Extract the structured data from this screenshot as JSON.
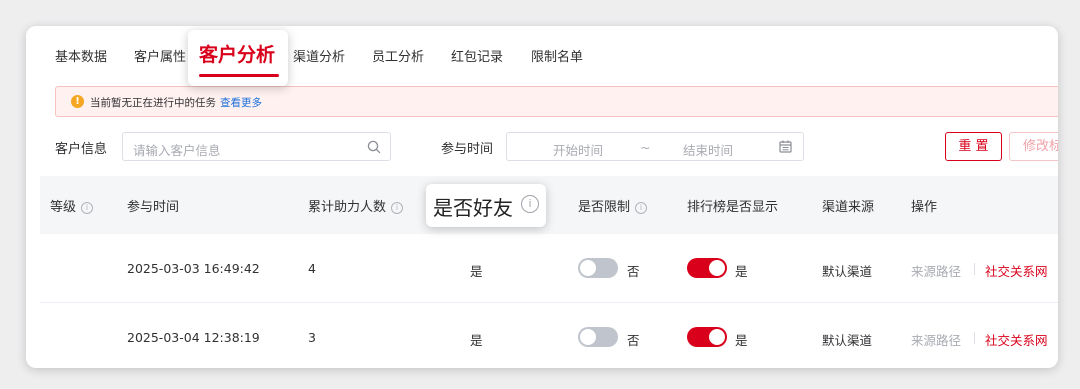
{
  "tabs": {
    "items": [
      "基本数据",
      "客户属性",
      "客户分析",
      "渠道分析",
      "员工分析",
      "红包记录",
      "限制名单"
    ],
    "active": "客户分析"
  },
  "alert": {
    "icon": "warning-icon",
    "text": "当前暂无正在进行中的任务",
    "link": "查看更多"
  },
  "filters": {
    "customer_label": "客户信息",
    "customer_placeholder": "请输入客户信息",
    "time_label": "参与时间",
    "start_placeholder": "开始时间",
    "separator": "~",
    "end_placeholder": "结束时间",
    "reset_button": "重 置",
    "edit_button": "修改标"
  },
  "table": {
    "headers": {
      "level": "等级",
      "time": "参与时间",
      "helpers": "累计助力人数",
      "friend": "是否好友",
      "limited": "是否限制",
      "ranking": "排行榜是否显示",
      "channel": "渠道来源",
      "actions": "操作"
    },
    "rows": [
      {
        "time": "2025-03-03 16:49:42",
        "helpers": "4",
        "friend": "是",
        "limited_on": false,
        "limited_text": "否",
        "ranking_on": true,
        "ranking_text": "是",
        "channel": "默认渠道",
        "action_source": "来源路径",
        "action_social": "社交关系网"
      },
      {
        "time": "2025-03-04 12:38:19",
        "helpers": "3",
        "friend": "是",
        "limited_on": false,
        "limited_text": "否",
        "ranking_on": true,
        "ranking_text": "是",
        "channel": "默认渠道",
        "action_source": "来源路径",
        "action_social": "社交关系网"
      }
    ]
  },
  "colors": {
    "accent": "#d9001b",
    "link": "#1e6fd9",
    "warning": "#f5a623"
  }
}
